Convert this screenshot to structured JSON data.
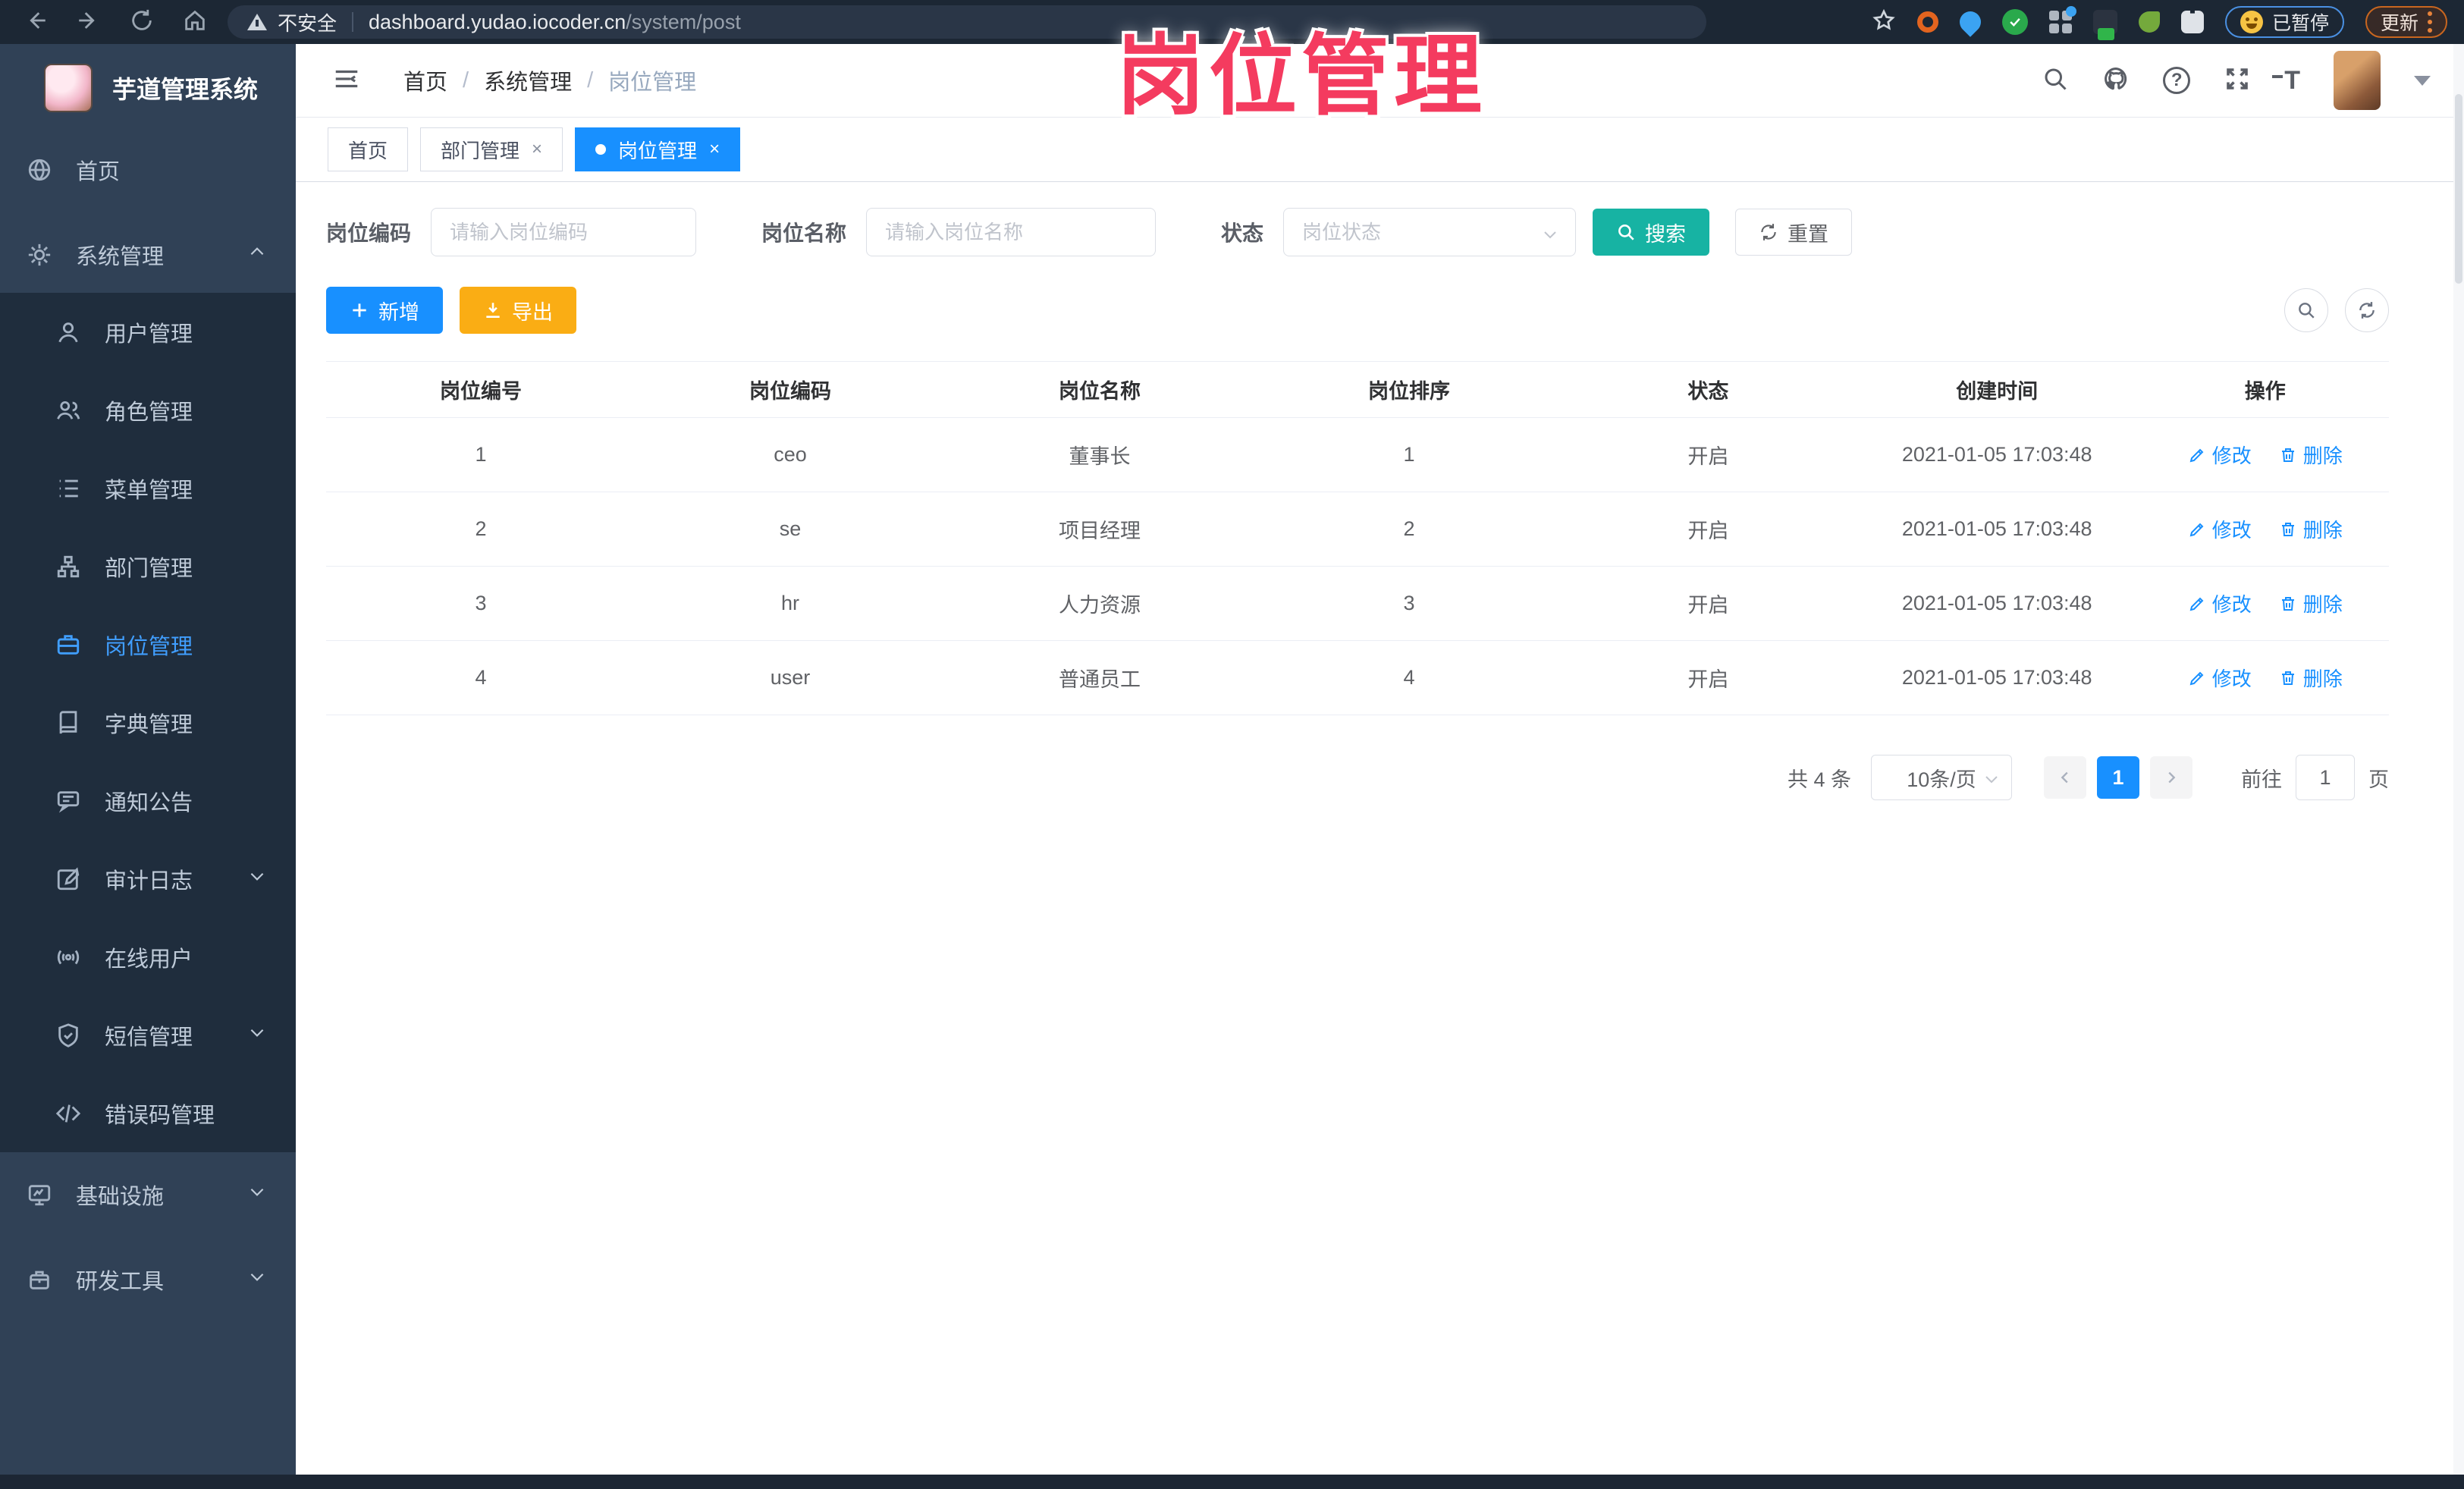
{
  "browser": {
    "security_label": "不安全",
    "url_host": "dashboard.yudao.iocoder.cn",
    "url_path": "/system/post",
    "paused_label": "已暂停",
    "update_label": "更新"
  },
  "watermark": {
    "text": "岗位管理",
    "color": "#f43b5f"
  },
  "sidebar": {
    "title": "芋道管理系统",
    "items": [
      {
        "label": "首页"
      },
      {
        "label": "系统管理"
      },
      {
        "label": "用户管理"
      },
      {
        "label": "角色管理"
      },
      {
        "label": "菜单管理"
      },
      {
        "label": "部门管理"
      },
      {
        "label": "岗位管理"
      },
      {
        "label": "字典管理"
      },
      {
        "label": "通知公告"
      },
      {
        "label": "审计日志"
      },
      {
        "label": "在线用户"
      },
      {
        "label": "短信管理"
      },
      {
        "label": "错误码管理"
      },
      {
        "label": "基础设施"
      },
      {
        "label": "研发工具"
      }
    ]
  },
  "header": {
    "breadcrumb": [
      "首页",
      "系统管理",
      "岗位管理"
    ],
    "breadcrumb_sep": "/",
    "help_glyph": "?",
    "font_glyph": "T"
  },
  "tabs": {
    "close_glyph": "×",
    "items": [
      {
        "label": "首页"
      },
      {
        "label": "部门管理"
      },
      {
        "label": "岗位管理"
      }
    ]
  },
  "filters": {
    "code_label": "岗位编码",
    "code_placeholder": "请输入岗位编码",
    "name_label": "岗位名称",
    "name_placeholder": "请输入岗位名称",
    "status_label": "状态",
    "status_placeholder": "岗位状态",
    "search_label": "搜索",
    "reset_label": "重置"
  },
  "toolbar": {
    "add_label": "新增",
    "export_label": "导出"
  },
  "table": {
    "columns": [
      "岗位编号",
      "岗位编码",
      "岗位名称",
      "岗位排序",
      "状态",
      "创建时间",
      "操作"
    ],
    "rows": [
      {
        "no": "1",
        "code": "ceo",
        "name": "董事长",
        "sort": "1",
        "status": "开启",
        "created": "2021-01-05 17:03:48"
      },
      {
        "no": "2",
        "code": "se",
        "name": "项目经理",
        "sort": "2",
        "status": "开启",
        "created": "2021-01-05 17:03:48"
      },
      {
        "no": "3",
        "code": "hr",
        "name": "人力资源",
        "sort": "3",
        "status": "开启",
        "created": "2021-01-05 17:03:48"
      },
      {
        "no": "4",
        "code": "user",
        "name": "普通员工",
        "sort": "4",
        "status": "开启",
        "created": "2021-01-05 17:03:48"
      }
    ],
    "edit_label": "修改",
    "delete_label": "删除"
  },
  "pagination": {
    "total_text": "共 4 条",
    "page_size_text": "10条/页",
    "current_page": "1",
    "goto_label": "前往",
    "goto_value": "1",
    "page_unit": "页"
  },
  "colors": {
    "accent_blue": "#1890ff",
    "search_teal": "#17b3a3",
    "export_orange": "#faad14",
    "watermark_pink": "#f43b5f",
    "sidebar_bg": "#304156",
    "submenu_bg": "#1f2d3d",
    "active_menu": "#409eff"
  }
}
